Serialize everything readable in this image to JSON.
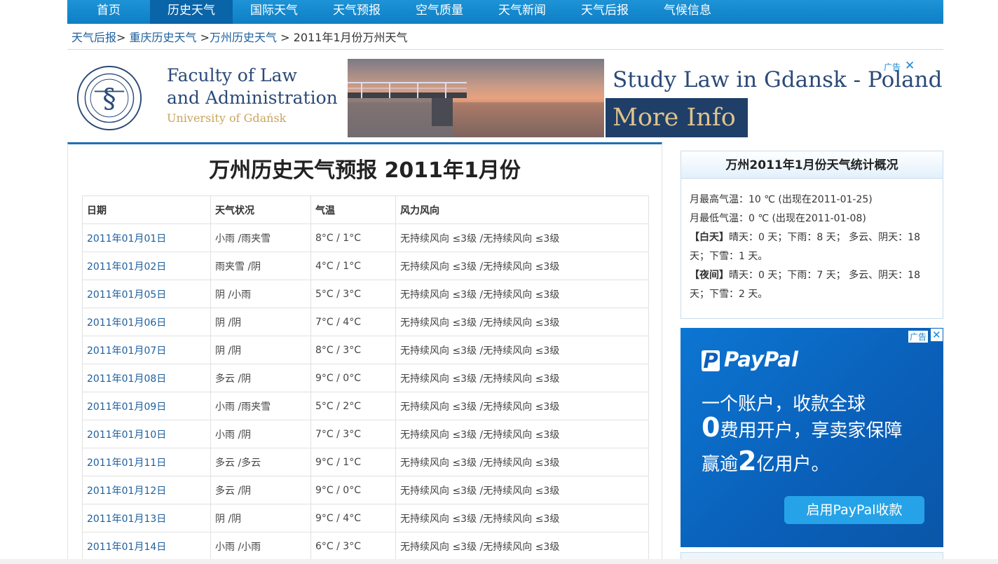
{
  "nav": {
    "items": [
      {
        "label": "首页"
      },
      {
        "label": "历史天气"
      },
      {
        "label": "国际天气"
      },
      {
        "label": "天气预报"
      },
      {
        "label": "空气质量"
      },
      {
        "label": "天气新闻"
      },
      {
        "label": "天气后报"
      },
      {
        "label": "气候信息"
      }
    ],
    "active": "历史天气"
  },
  "breadcrumb": {
    "c1": "天气后报",
    "sep1": ">",
    "c2": "重庆历史天气",
    "sep2": ">",
    "c3": "万州历史天气",
    "sep3": ">",
    "current": "2011年1月份万州天气"
  },
  "top_ad": {
    "faculty_line1": "Faculty of Law",
    "faculty_line2": "and Administration",
    "faculty_line3": "University of Gdańsk",
    "headline": "Study Law in Gdansk - Poland",
    "button": "More Info",
    "ad_tag": "广告",
    "close": "✕"
  },
  "main": {
    "title": "万州历史天气预报 2011年1月份",
    "headers": {
      "date": "日期",
      "cond": "天气状况",
      "temp": "气温",
      "wind": "风力风向"
    },
    "rows": [
      {
        "date": "2011年01月01日",
        "cond": "小雨 /雨夹雪",
        "temp": "8°C / 1°C",
        "wind": "无持续风向 ≤3级 /无持续风向 ≤3级"
      },
      {
        "date": "2011年01月02日",
        "cond": "雨夹雪 /阴",
        "temp": "4°C / 1°C",
        "wind": "无持续风向 ≤3级 /无持续风向 ≤3级"
      },
      {
        "date": "2011年01月05日",
        "cond": "阴 /小雨",
        "temp": "5°C / 3°C",
        "wind": "无持续风向 ≤3级 /无持续风向 ≤3级"
      },
      {
        "date": "2011年01月06日",
        "cond": "阴 /阴",
        "temp": "7°C / 4°C",
        "wind": "无持续风向 ≤3级 /无持续风向 ≤3级"
      },
      {
        "date": "2011年01月07日",
        "cond": "阴 /阴",
        "temp": "8°C / 3°C",
        "wind": "无持续风向 ≤3级 /无持续风向 ≤3级"
      },
      {
        "date": "2011年01月08日",
        "cond": "多云 /阴",
        "temp": "9°C / 0°C",
        "wind": "无持续风向 ≤3级 /无持续风向 ≤3级"
      },
      {
        "date": "2011年01月09日",
        "cond": "小雨 /雨夹雪",
        "temp": "5°C / 2°C",
        "wind": "无持续风向 ≤3级 /无持续风向 ≤3级"
      },
      {
        "date": "2011年01月10日",
        "cond": "小雨 /阴",
        "temp": "7°C / 3°C",
        "wind": "无持续风向 ≤3级 /无持续风向 ≤3级"
      },
      {
        "date": "2011年01月11日",
        "cond": "多云 /多云",
        "temp": "9°C / 1°C",
        "wind": "无持续风向 ≤3级 /无持续风向 ≤3级"
      },
      {
        "date": "2011年01月12日",
        "cond": "多云 /阴",
        "temp": "9°C / 0°C",
        "wind": "无持续风向 ≤3级 /无持续风向 ≤3级"
      },
      {
        "date": "2011年01月13日",
        "cond": "阴 /阴",
        "temp": "9°C / 4°C",
        "wind": "无持续风向 ≤3级 /无持续风向 ≤3级"
      },
      {
        "date": "2011年01月14日",
        "cond": "小雨 /小雨",
        "temp": "6°C / 3°C",
        "wind": "无持续风向 ≤3级 /无持续风向 ≤3级"
      }
    ]
  },
  "stats": {
    "title": "万州2011年1月份天气统计概况",
    "max": "月最高气温：10 ℃ (出现在2011-01-25)",
    "min": "月最低气温：0 ℃ (出现在2011-01-08)",
    "day_label": "【白天】",
    "day_text": "晴天：0 天；下雨：8 天； 多云、阴天：18 天；下雪：1 天。",
    "night_label": "【夜间】",
    "night_text": "晴天：0 天；下雨：7 天； 多云、阴天：18 天；下雪：2 天。"
  },
  "paypal_ad": {
    "logo": "PayPal",
    "line1": "一个账户，收款全球",
    "line2_big": "0",
    "line2": "费用开户，享卖家保障",
    "line3_pre": "赢逾",
    "line3_big": "2",
    "line3_post": "亿用户。",
    "button": "启用PayPal收款",
    "ad_tag": "广告",
    "close": "✕"
  },
  "colors": {
    "nav": "#0d7fc6",
    "link": "#1d5f9d",
    "accent": "#1e70b4",
    "paypal": "#0a5fb8"
  }
}
